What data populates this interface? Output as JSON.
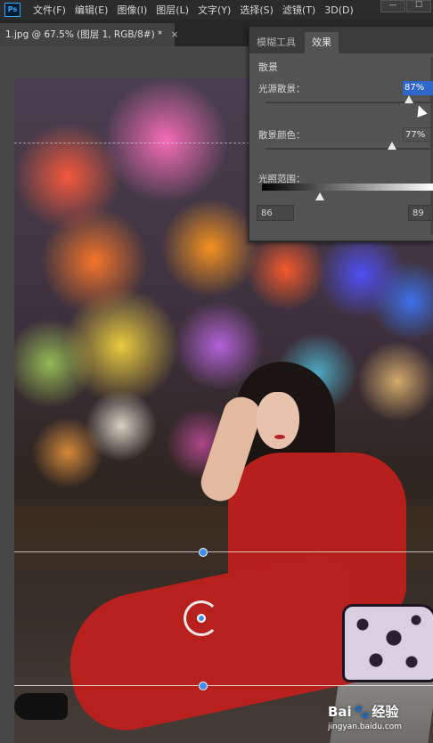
{
  "app": {
    "logo_text": "Ps"
  },
  "menu": {
    "items": [
      "文件(F)",
      "编辑(E)",
      "图像(I)",
      "图层(L)",
      "文字(Y)",
      "选择(S)",
      "滤镜(T)",
      "3D(D)"
    ],
    "minimize_label": "—",
    "restore_label": "☐"
  },
  "document_tab": {
    "title": "1.jpg @ 67.5% (图层 1, RGB/8#) *",
    "close_label": "×"
  },
  "panel": {
    "tabs": [
      {
        "label": "模糊工具",
        "active": false
      },
      {
        "label": "效果",
        "active": true
      }
    ],
    "section_title": "散景",
    "sliders": [
      {
        "label": "光源散景：",
        "value_text": "87%",
        "value": 87,
        "selected": true
      },
      {
        "label": "散景颜色：",
        "value_text": "77%",
        "value": 77,
        "selected": false
      }
    ],
    "light_range": {
      "label": "光照范围：",
      "low": "86",
      "high": "89",
      "thumb_value": 86
    }
  },
  "watermark": {
    "brand": "Bai",
    "paw": "🐾",
    "brand_suffix": "经验",
    "url": "jingyan.baidu.com"
  },
  "colors": {
    "panel_bg": "#535353",
    "selection_blue": "#2f66c9",
    "pin_blue": "#3c8ff0",
    "menubar_bg": "#2b2b2b"
  }
}
